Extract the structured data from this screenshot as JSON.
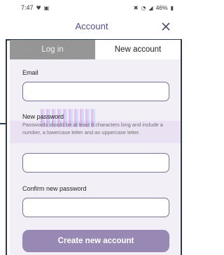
{
  "status_bar": {
    "time": "7:47",
    "battery": "46%"
  },
  "header": {
    "title": "Account"
  },
  "tabs": [
    {
      "label": "Log in",
      "active": false
    },
    {
      "label": "New account",
      "active": true
    }
  ],
  "form": {
    "email_label": "Email",
    "email_value": "",
    "new_password_label": "New password",
    "password_hint": "Passwords should be at least 8 characters long and include a number, a lowercase letter and an uppercase letter.",
    "new_password_value": "",
    "confirm_label": "Confirm new password",
    "confirm_value": "",
    "submit_label": "Create new account"
  },
  "colors": {
    "accent": "#5b4a86",
    "button": "#9889b4",
    "form_bg": "#f3eff6",
    "inactive_tab": "#959595"
  }
}
